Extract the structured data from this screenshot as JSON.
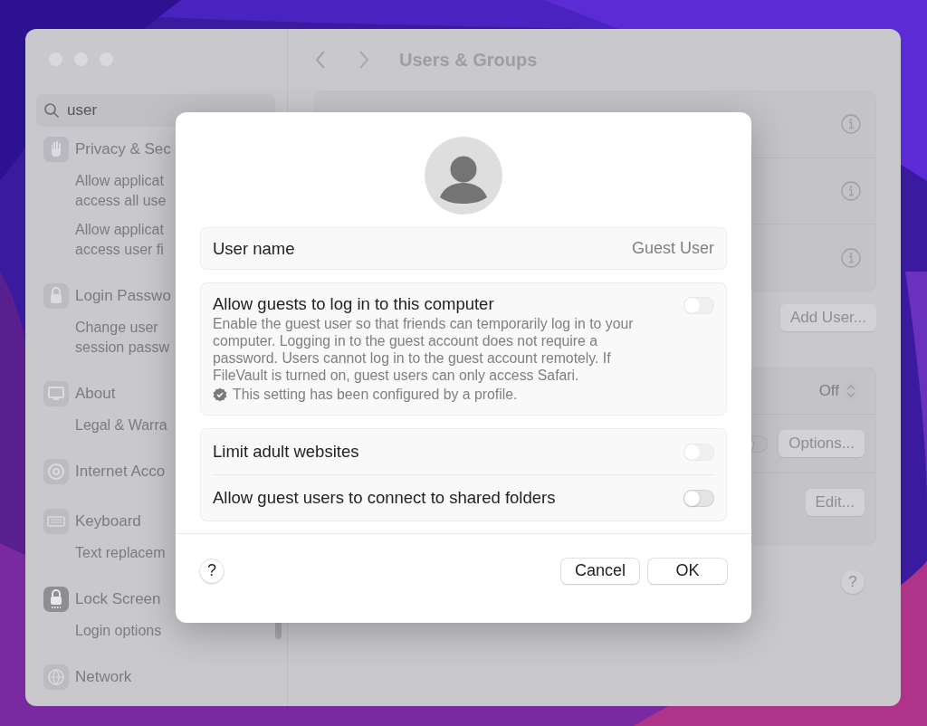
{
  "sidebar": {
    "search": {
      "value": "user"
    },
    "items": [
      {
        "title": "Privacy & Sec",
        "children": [
          {
            "lines": [
              "Allow applicat",
              "access all use"
            ]
          },
          {
            "lines": [
              "Allow applicat",
              "access user fi"
            ]
          }
        ]
      },
      {
        "title": "Login Passwo",
        "children": [
          {
            "lines": [
              "Change user",
              "session passw"
            ]
          }
        ]
      },
      {
        "title": "About",
        "children": [
          {
            "lines": [
              "Legal & Warra"
            ]
          }
        ]
      },
      {
        "title": "Internet Acco"
      },
      {
        "title": "Keyboard",
        "children": [
          {
            "lines": [
              "Text replacem"
            ]
          }
        ]
      },
      {
        "title": "Lock Screen",
        "children": [
          {
            "lines": [
              "Login options"
            ]
          }
        ]
      },
      {
        "title": "Network"
      }
    ]
  },
  "pane": {
    "title": "Users & Groups",
    "add_button": "Add User...",
    "settings": [
      {
        "kind": "stepper",
        "value": "Off"
      },
      {
        "kind": "button",
        "label": "Options...",
        "on": false
      },
      {
        "kind": "button",
        "label": "Edit..."
      }
    ],
    "help": "?"
  },
  "dialog": {
    "user_name": {
      "label": "User name",
      "value": "Guest User"
    },
    "guest_access": {
      "title": "Allow guests to log in to this computer",
      "description": "Enable the guest user so that friends can temporarily log in to your computer. Logging in to the guest account does not require a password. Users cannot log in to the guest account remotely. If FileVault is turned on, guest users can only access Safari.",
      "note": "This setting has been configured by a profile.",
      "on": false,
      "disabled": true
    },
    "options": [
      {
        "label": "Limit adult websites",
        "on": false,
        "disabled": true
      },
      {
        "label": "Allow guest users to connect to shared folders",
        "on": false,
        "disabled": false
      }
    ],
    "help": "?",
    "buttons": [
      "Cancel",
      "OK"
    ]
  }
}
